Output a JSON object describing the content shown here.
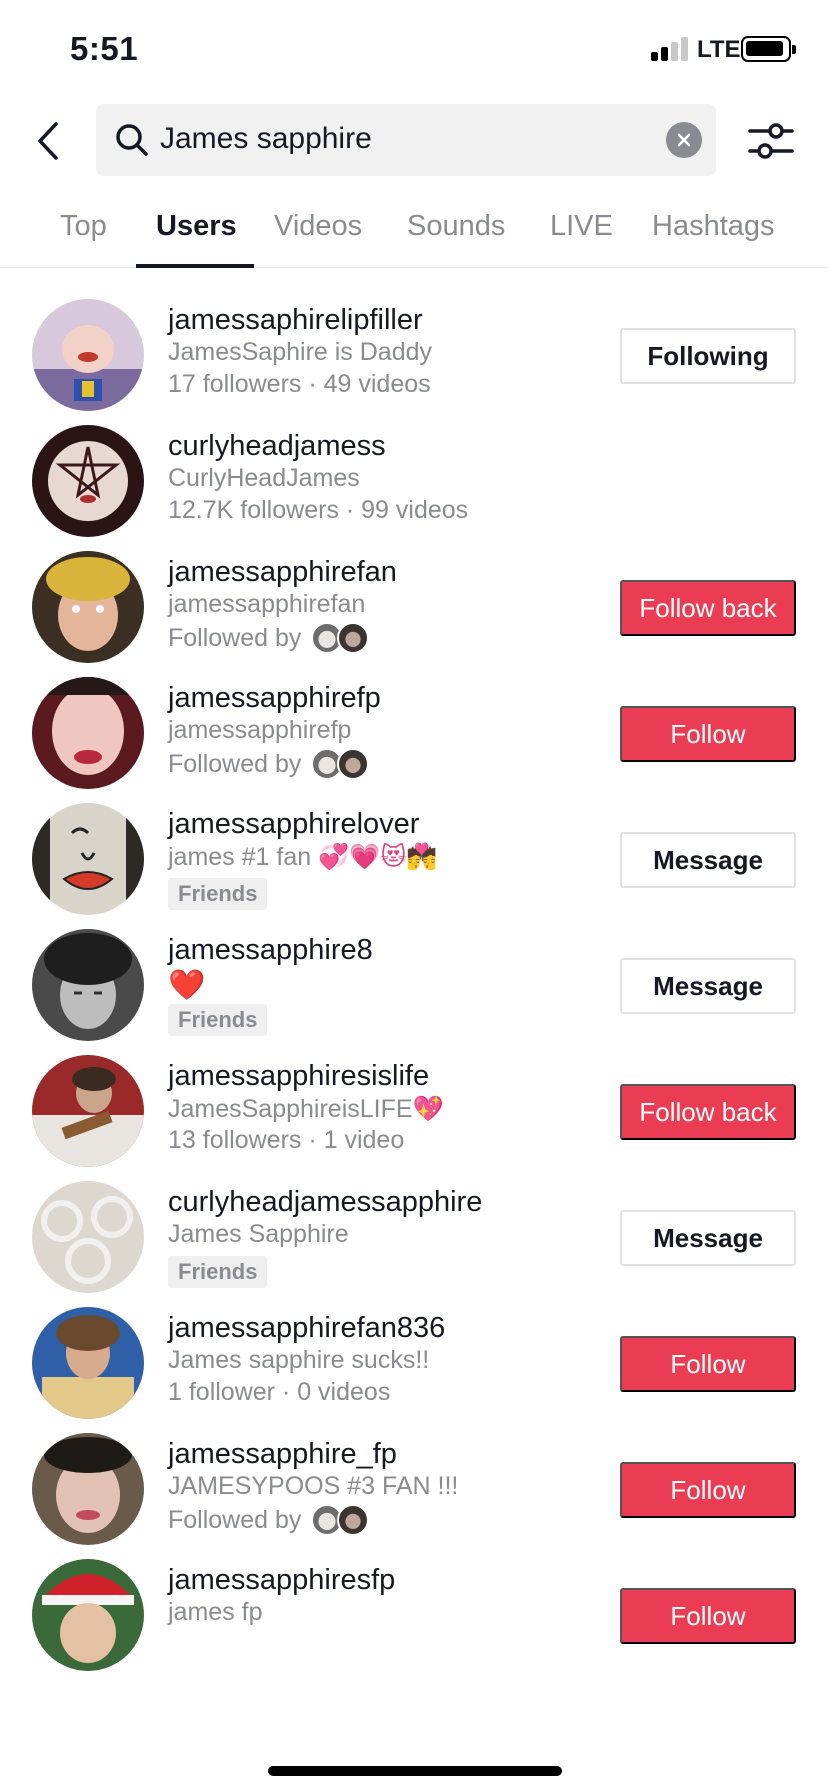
{
  "status_bar": {
    "time": "5:51",
    "network": "LTE"
  },
  "search": {
    "query": "James sapphire"
  },
  "tabs": [
    {
      "label": "Top",
      "active": false
    },
    {
      "label": "Users",
      "active": true
    },
    {
      "label": "Videos",
      "active": false
    },
    {
      "label": "Sounds",
      "active": false
    },
    {
      "label": "LIVE",
      "active": false
    },
    {
      "label": "Hashtags",
      "active": false
    }
  ],
  "users": [
    {
      "username": "jamessaphirelipfiller",
      "nickname": "JamesSaphire is Daddy",
      "meta": "17 followers · 49 videos",
      "button": "Following"
    },
    {
      "username": "curlyheadjamess",
      "nickname": "CurlyHeadJames",
      "meta": "12.7K followers · 99 videos",
      "button": ""
    },
    {
      "username": "jamessapphirefan",
      "nickname": "jamessapphirefan",
      "followed_by": "Followed by",
      "button": "Follow back"
    },
    {
      "username": "jamessapphirefp",
      "nickname": "jamessapphirefp",
      "followed_by": "Followed by",
      "button": "Follow"
    },
    {
      "username": "jamessapphirelover",
      "nickname": "james #1 fan",
      "nickname_emoji": "💞💗😻💏",
      "badge": "Friends",
      "button": "Message"
    },
    {
      "username": "jamessapphire8",
      "nickname": "❤️",
      "badge": "Friends",
      "button": "Message"
    },
    {
      "username": "jamessapphiresislife",
      "nickname": "JamesSapphireisLIFE",
      "nickname_emoji": "💖",
      "meta": "13 followers · 1 video",
      "button": "Follow back"
    },
    {
      "username": "curlyheadjamessapphire",
      "nickname": "James Sapphire",
      "badge": "Friends",
      "button": "Message"
    },
    {
      "username": "jamessapphirefan836",
      "nickname": "James sapphire sucks!!",
      "meta": "1 follower · 0 videos",
      "button": "Follow"
    },
    {
      "username": "jamessapphire_fp",
      "nickname": "JAMESYPOOS #3 FAN !!!",
      "followed_by": "Followed by",
      "button": "Follow"
    },
    {
      "username": "jamessapphiresfp",
      "nickname": "james fp",
      "button": "Follow"
    }
  ],
  "colors": {
    "accent": "#ea3c53",
    "text": "#161823",
    "muted": "#8a8b91"
  }
}
